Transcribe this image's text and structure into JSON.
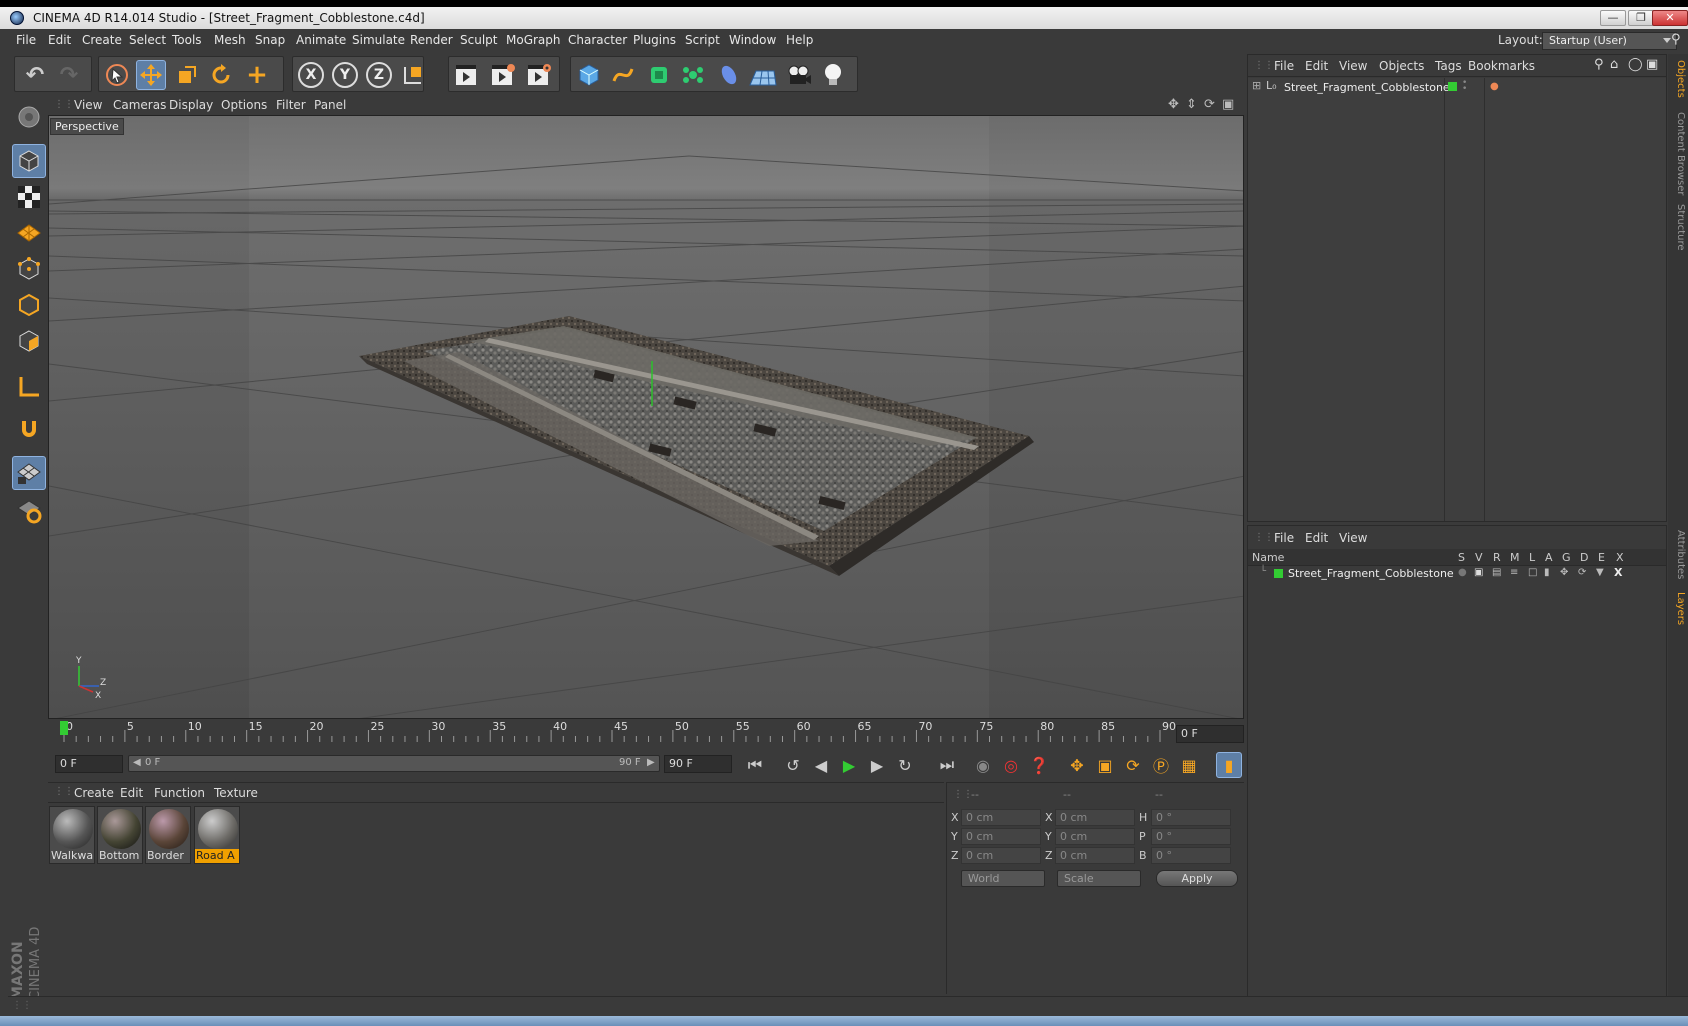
{
  "window": {
    "title": "CINEMA 4D R14.014 Studio - [Street_Fragment_Cobblestone.c4d]",
    "controls": [
      "minimize-icon",
      "restore-icon",
      "close-icon"
    ]
  },
  "menubar": {
    "items": [
      "File",
      "Edit",
      "Create",
      "Select",
      "Tools",
      "Mesh",
      "Snap",
      "Animate",
      "Simulate",
      "Render",
      "Sculpt",
      "MoGraph",
      "Character",
      "Plugins",
      "Script",
      "Window",
      "Help"
    ],
    "layout_label": "Layout:",
    "layout_value": "Startup (User)"
  },
  "toolbar": {
    "tools": [
      "undo-icon",
      "redo-icon",
      "live-selection-icon",
      "move-icon",
      "scale-icon",
      "rotate-icon",
      "last-tool-icon",
      "x-axis-icon",
      "y-axis-icon",
      "z-axis-icon",
      "coordinate-system-icon",
      "render-view-icon",
      "render-picture-viewer-icon",
      "render-settings-icon",
      "cube-icon",
      "spline-icon",
      "nurbs-icon",
      "mograph-cloner-icon",
      "deformer-icon",
      "floor-icon",
      "camera-icon",
      "light-icon"
    ],
    "axis_labels": [
      "X",
      "Y",
      "Z"
    ]
  },
  "viewport": {
    "menus": [
      "View",
      "Cameras",
      "Display",
      "Options",
      "Filter",
      "Panel"
    ],
    "view_name": "Perspective",
    "axis_y": "Y",
    "axis_z": "Z",
    "axis_x": "X"
  },
  "timeline": {
    "ticks": [
      "0",
      "5",
      "10",
      "15",
      "20",
      "25",
      "30",
      "35",
      "40",
      "45",
      "50",
      "55",
      "60",
      "65",
      "70",
      "75",
      "80",
      "85",
      "90"
    ],
    "current_frame": "0 F"
  },
  "transport": {
    "start_field": "0 F",
    "range_start": "0 F",
    "range_end": "90 F",
    "end_field": "90 F"
  },
  "material_manager": {
    "menus": [
      "Create",
      "Edit",
      "Function",
      "Texture"
    ],
    "materials": [
      {
        "label": "Walkwa",
        "color": "#6a6a66",
        "selected": false
      },
      {
        "label": "Bottom",
        "color": "#5a5550",
        "selected": false
      },
      {
        "label": "Border",
        "color": "#6b5e54",
        "selected": false
      },
      {
        "label": "Road A",
        "color": "#7a7872",
        "selected": true
      }
    ]
  },
  "coordinates": {
    "header": [
      "--",
      "--",
      "--"
    ],
    "rows": [
      {
        "axis1": "X",
        "pos": "0 cm",
        "axis2": "X",
        "size": "0 cm",
        "axis3": "H",
        "rot": "0 °"
      },
      {
        "axis1": "Y",
        "pos": "0 cm",
        "axis2": "Y",
        "size": "0 cm",
        "axis3": "P",
        "rot": "0 °"
      },
      {
        "axis1": "Z",
        "pos": "0 cm",
        "axis2": "Z",
        "size": "0 cm",
        "axis3": "B",
        "rot": "0 °"
      }
    ],
    "mode_select": "World",
    "size_select": "Scale",
    "apply": "Apply"
  },
  "object_manager": {
    "menus": [
      "File",
      "Edit",
      "View",
      "Objects",
      "Tags",
      "Bookmarks"
    ],
    "object_name": "Street_Fragment_Cobblestone"
  },
  "layer_manager": {
    "menus": [
      "File",
      "Edit",
      "View"
    ],
    "columns": [
      "Name",
      "S",
      "V",
      "R",
      "M",
      "L",
      "A",
      "G",
      "D",
      "E",
      "X"
    ],
    "layer_name": "Street_Fragment_Cobblestone"
  },
  "side_tabs": [
    "Objects",
    "Content Browser",
    "Structure",
    "Attributes",
    "Layers"
  ],
  "brand": {
    "maxon": "MAXON",
    "cinema": "CINEMA 4D"
  },
  "colors": {
    "accent_blue": "#5e7fa6",
    "layer_green": "#33cc33",
    "selection_orange": "#f0a000"
  }
}
